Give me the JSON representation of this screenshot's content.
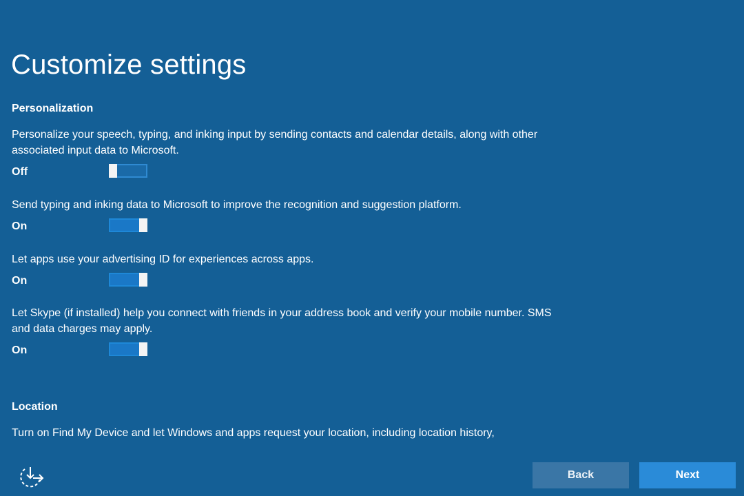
{
  "title": "Customize settings",
  "personalization": {
    "heading": "Personalization",
    "settings": [
      {
        "description": "Personalize your speech, typing, and inking input by sending contacts and calendar details, along with other associated input data to Microsoft.",
        "state": "Off",
        "enabled": false
      },
      {
        "description": "Send typing and inking data to Microsoft to improve the recognition and suggestion platform.",
        "state": "On",
        "enabled": true
      },
      {
        "description": "Let apps use your advertising ID for experiences across apps.",
        "state": "On",
        "enabled": true
      },
      {
        "description": "Let Skype (if installed) help you connect with friends in your address book and verify your mobile number. SMS and data charges may apply.",
        "state": "On",
        "enabled": true
      }
    ]
  },
  "location": {
    "heading": "Location",
    "description": "Turn on Find My Device and let Windows and apps request your location, including location history,"
  },
  "footer": {
    "progress_icon": "ease-of-access-icon",
    "back_label": "Back",
    "next_label": "Next"
  },
  "colors": {
    "background": "#145f96",
    "toggle_on": "#1a78c7",
    "back_button": "#3a76a6",
    "next_button": "#2a8bd8"
  }
}
